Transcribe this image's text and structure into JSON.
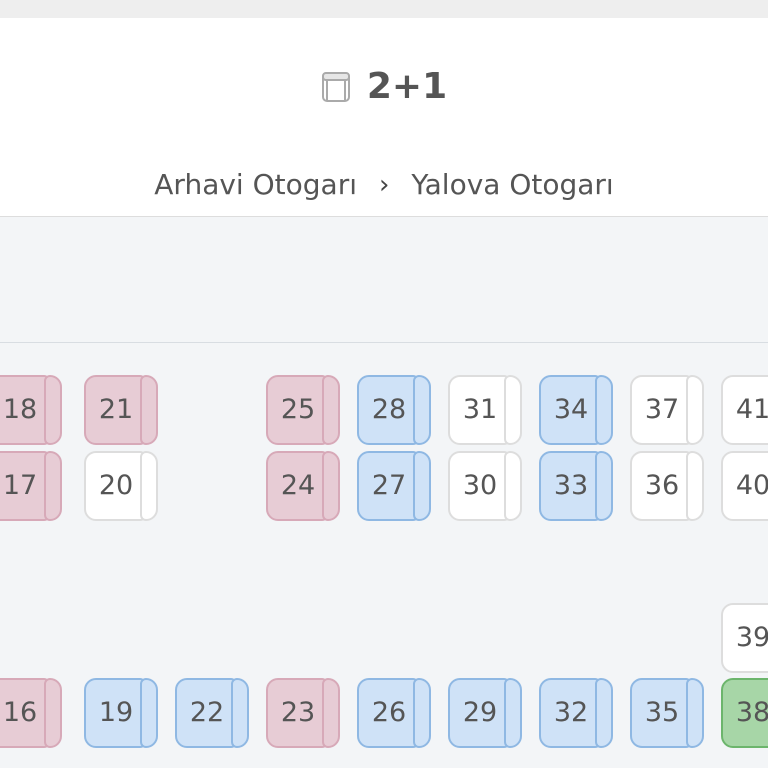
{
  "header": {
    "layout_icon": "bus-seat-icon",
    "layout_label": "2+1",
    "route": {
      "from": "Arhavi Otogarı",
      "separator": "›",
      "to": "Yalova Otogarı"
    }
  },
  "colors": {
    "sold_female": "#e7ccd5",
    "sold_male": "#cfe2f7",
    "available": "#ffffff",
    "selected": "#a7d6a7",
    "background": "#f3f5f7"
  },
  "seats": [
    {
      "number": "18",
      "status": "sold-female"
    },
    {
      "number": "21",
      "status": "sold-female"
    },
    {
      "number": "25",
      "status": "sold-female"
    },
    {
      "number": "28",
      "status": "sold-male"
    },
    {
      "number": "31",
      "status": "available"
    },
    {
      "number": "34",
      "status": "sold-male"
    },
    {
      "number": "37",
      "status": "available"
    },
    {
      "number": "41",
      "status": "available"
    },
    {
      "number": "17",
      "status": "sold-female"
    },
    {
      "number": "20",
      "status": "available"
    },
    {
      "number": "24",
      "status": "sold-female"
    },
    {
      "number": "27",
      "status": "sold-male"
    },
    {
      "number": "30",
      "status": "available"
    },
    {
      "number": "33",
      "status": "sold-male"
    },
    {
      "number": "36",
      "status": "available"
    },
    {
      "number": "40",
      "status": "available"
    },
    {
      "number": "39",
      "status": "available"
    },
    {
      "number": "16",
      "status": "sold-female"
    },
    {
      "number": "19",
      "status": "sold-male"
    },
    {
      "number": "22",
      "status": "sold-male"
    },
    {
      "number": "23",
      "status": "sold-female"
    },
    {
      "number": "26",
      "status": "sold-male"
    },
    {
      "number": "29",
      "status": "sold-male"
    },
    {
      "number": "32",
      "status": "sold-male"
    },
    {
      "number": "35",
      "status": "sold-male"
    },
    {
      "number": "38",
      "status": "selected"
    }
  ]
}
